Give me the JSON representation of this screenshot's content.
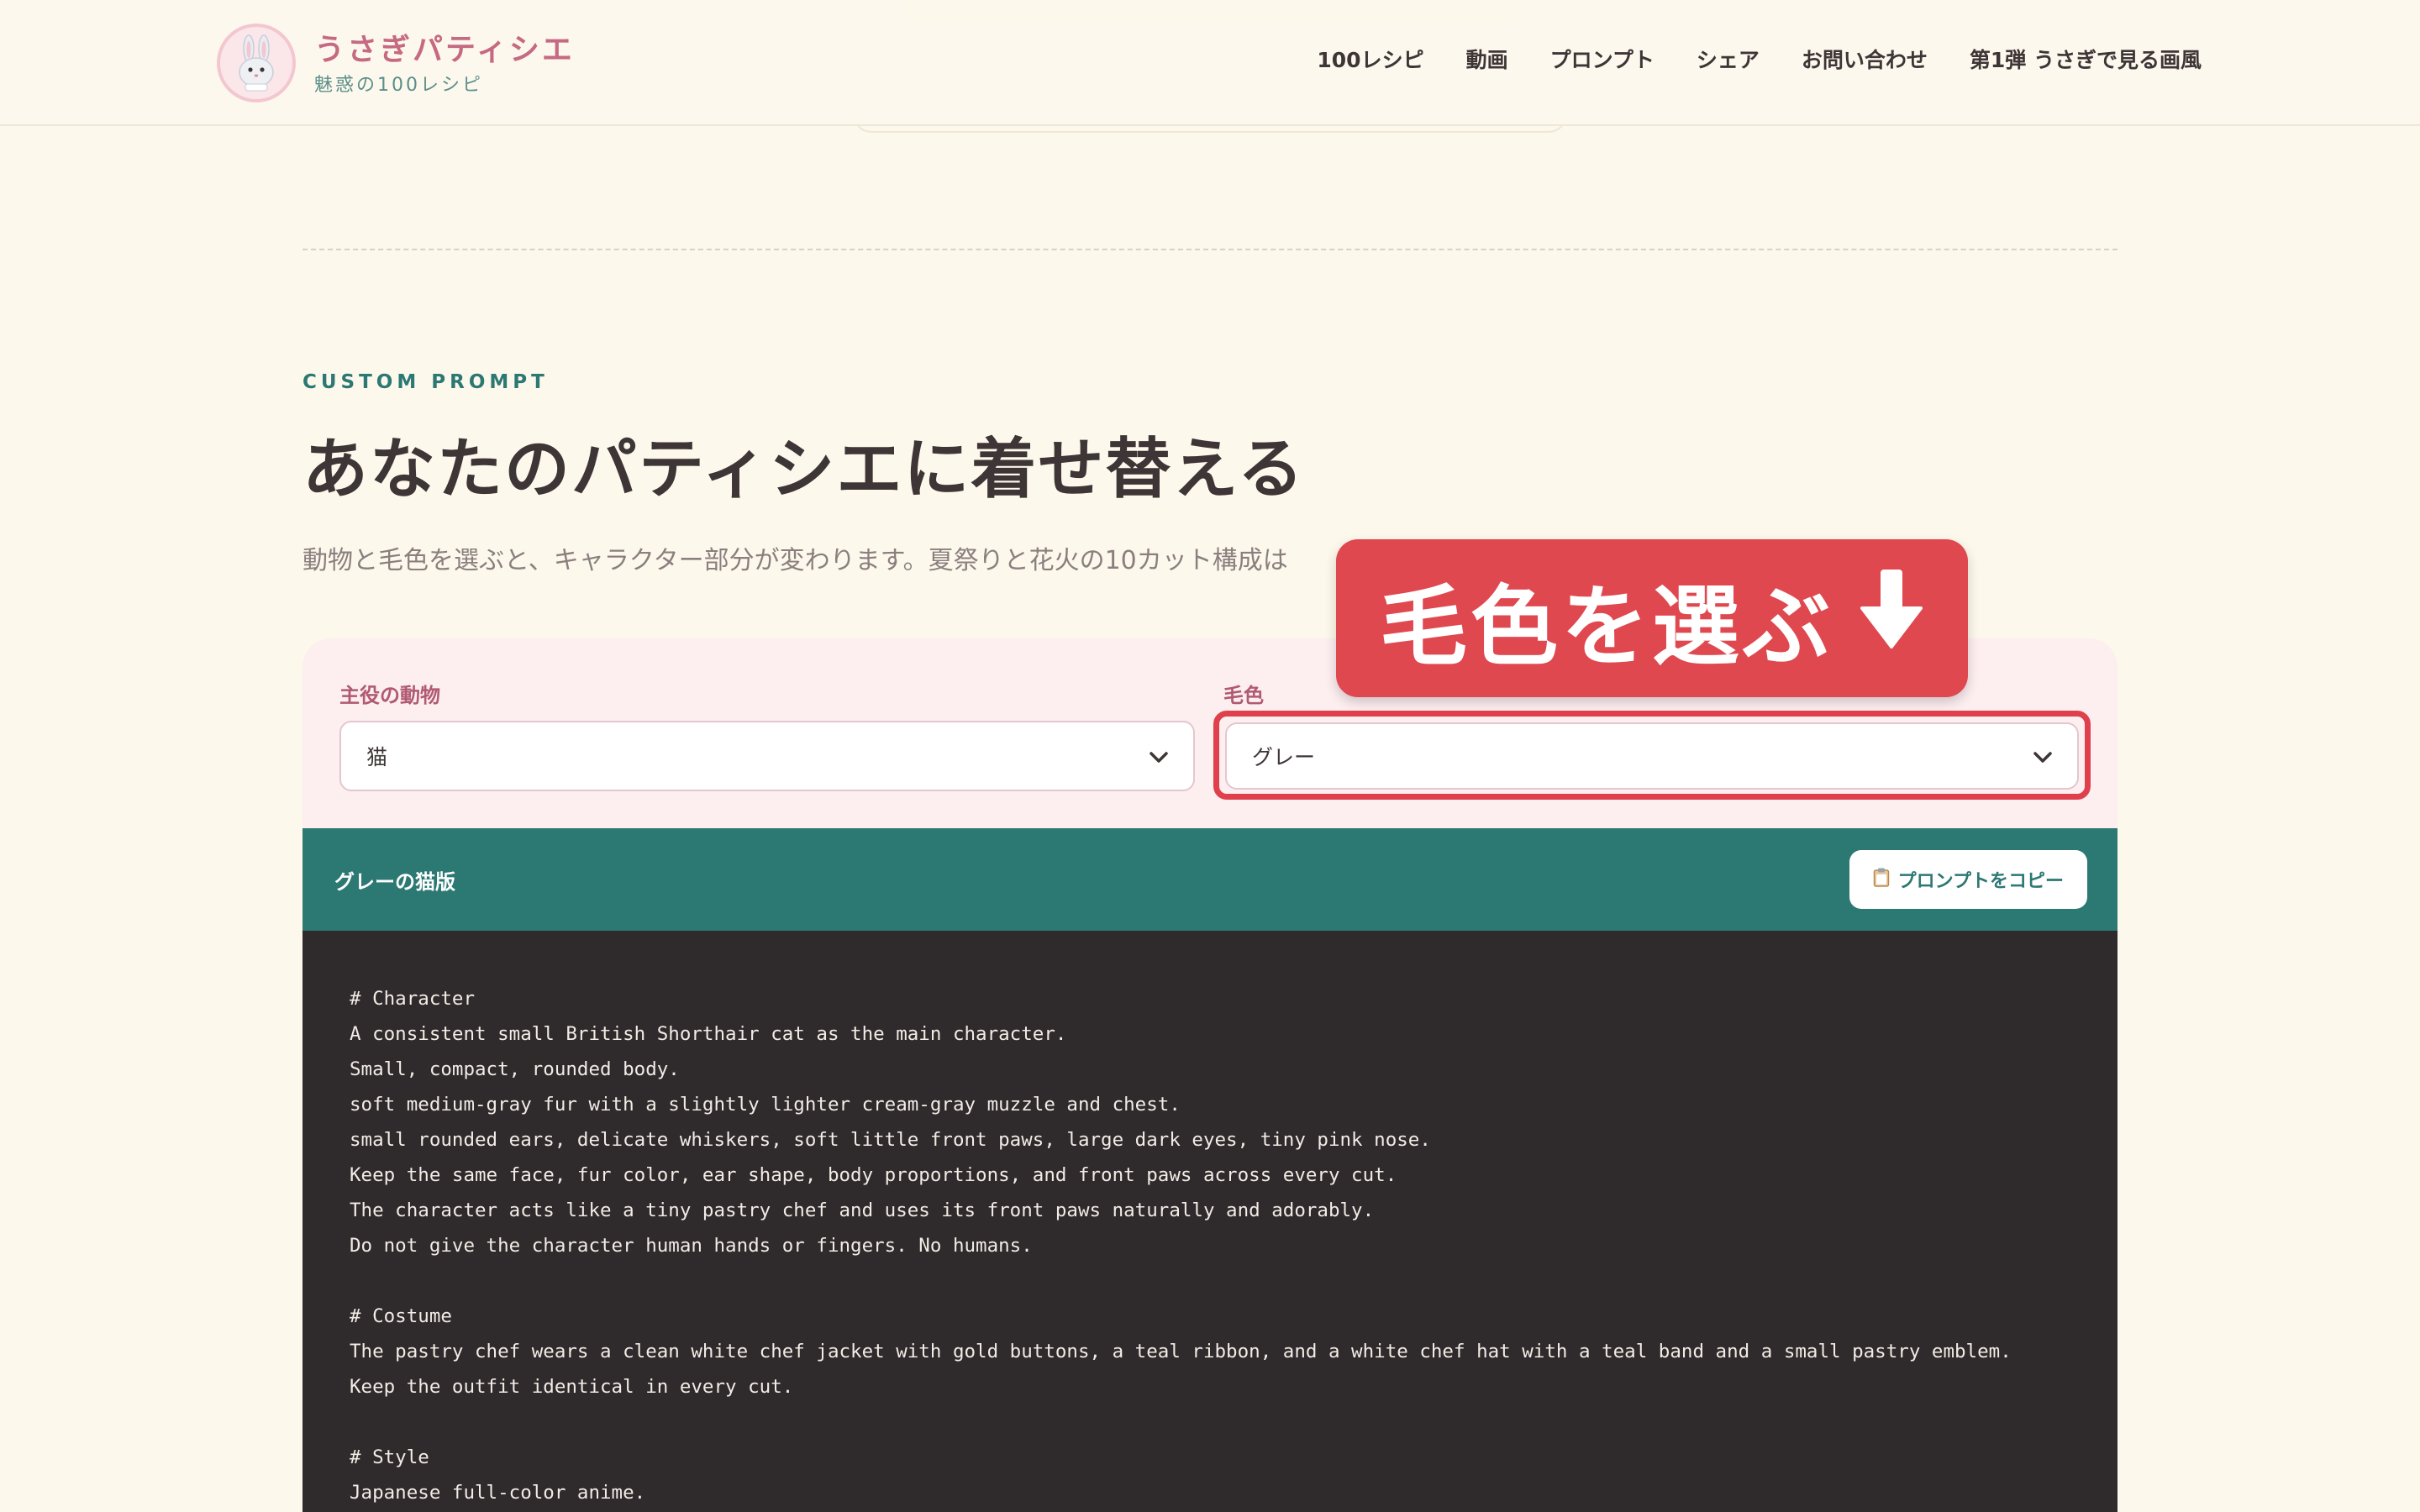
{
  "header": {
    "brand_title": "うさぎパティシエ",
    "brand_subtitle": "魅惑の100レシピ",
    "nav": [
      "100レシピ",
      "動画",
      "プロンプト",
      "シェア",
      "お問い合わせ",
      "第1弾 うさぎで見る画風"
    ]
  },
  "section": {
    "eyebrow": "CUSTOM PROMPT",
    "title": "あなたのパティシエに着せ替える",
    "description": "動物と毛色を選ぶと、キャラクター部分が変わります。夏祭りと花火の10カット構成は"
  },
  "selectors": {
    "animal_label": "主役の動物",
    "animal_value": "猫",
    "color_label": "毛色",
    "color_value": "グレー"
  },
  "callout": {
    "text": "毛色を選ぶ",
    "icon": "arrow-down-icon"
  },
  "prompt_card": {
    "title": "グレーの猫版",
    "copy_button": "プロンプトをコピー",
    "copy_icon": "clipboard-icon",
    "lines": [
      "# Character",
      "A consistent small British Shorthair cat as the main character.",
      "Small, compact, rounded body.",
      "soft medium-gray fur with a slightly lighter cream-gray muzzle and chest.",
      "small rounded ears, delicate whiskers, soft little front paws, large dark eyes, tiny pink nose.",
      "Keep the same face, fur color, ear shape, body proportions, and front paws across every cut.",
      "The character acts like a tiny pastry chef and uses its front paws naturally and adorably.",
      "Do not give the character human hands or fingers. No humans.",
      "",
      "# Costume",
      "The pastry chef wears a clean white chef jacket with gold buttons, a teal ribbon, and a white chef hat with a teal band and a small pastry emblem.",
      "Keep the outfit identical in every cut.",
      "",
      "# Style",
      "Japanese full-color anime."
    ]
  },
  "colors": {
    "accent_teal": "#2c7873",
    "brand_pink": "#c56a82",
    "callout_red": "#e04850",
    "page_bg": "#fdf8ec",
    "code_bg": "#2f2a2b"
  }
}
